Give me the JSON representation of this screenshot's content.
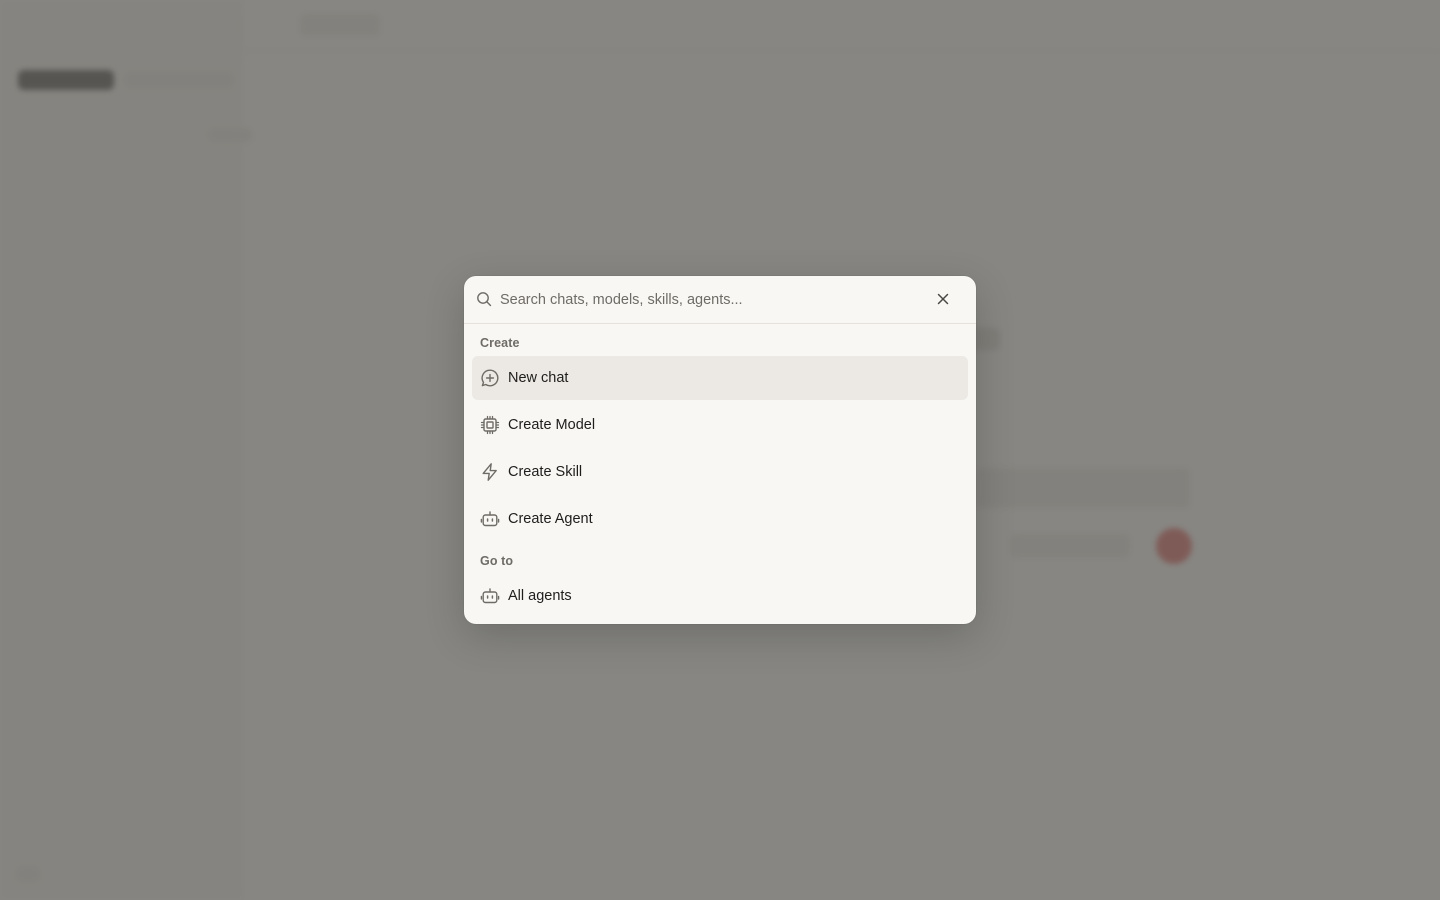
{
  "palette": {
    "search": {
      "placeholder": "Search chats, models, skills, agents...",
      "value": ""
    },
    "sections": [
      {
        "label": "Create",
        "items": [
          {
            "label": "New chat",
            "icon": "message-plus-icon",
            "active": true
          },
          {
            "label": "Create Model",
            "icon": "cpu-chip-icon",
            "active": false
          },
          {
            "label": "Create Skill",
            "icon": "lightning-bolt-icon",
            "active": false
          },
          {
            "label": "Create Agent",
            "icon": "robot-icon",
            "active": false
          }
        ]
      },
      {
        "label": "Go to",
        "items": [
          {
            "label": "All agents",
            "icon": "robot-icon",
            "active": false
          }
        ]
      }
    ]
  },
  "colors": {
    "overlay": "#605e5a",
    "palette_bg": "#f8f7f4",
    "active_item_bg": "#ece9e4",
    "icon_stroke": "#6f6c66"
  }
}
